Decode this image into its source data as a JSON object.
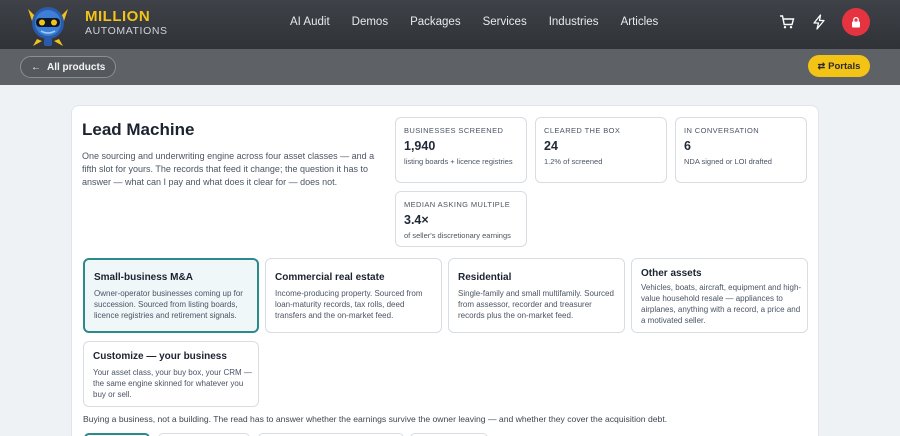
{
  "header": {
    "brand_top": "MILLION",
    "brand_bottom": "AUTOMATIONS",
    "nav": [
      "AI Audit",
      "Demos",
      "Packages",
      "Services",
      "Industries",
      "Articles"
    ],
    "icons": [
      "cart-icon",
      "bolt-icon",
      "lock-icon"
    ]
  },
  "subbar": {
    "back_label": "All products",
    "portals_label": "Portals"
  },
  "product": {
    "title": "Lead Machine",
    "description": "One sourcing and underwriting engine across four asset classes — and a fifth slot for yours. The records that feed it change; the question it has to answer — what can I pay and what does it clear for — does not."
  },
  "stats": [
    {
      "label": "BUSINESSES SCREENED",
      "value": "1,940",
      "note": "listing boards + licence registries"
    },
    {
      "label": "CLEARED THE BOX",
      "value": "24",
      "note": "1.2% of screened"
    },
    {
      "label": "IN CONVERSATION",
      "value": "6",
      "note": "NDA signed or LOI drafted"
    },
    {
      "label": "MEDIAN ASKING MULTIPLE",
      "value": "3.4×",
      "note": "of seller's discretionary earnings"
    }
  ],
  "asset_classes": [
    {
      "title": "Small-business M&A",
      "desc": "Owner-operator businesses coming up for succession. Sourced from listing boards, licence registries and retirement signals.",
      "active": true
    },
    {
      "title": "Commercial real estate",
      "desc": "Income-producing property. Sourced from loan-maturity records, tax rolls, deed transfers and the on-market feed.",
      "active": false
    },
    {
      "title": "Residential",
      "desc": "Single-family and small multifamily. Sourced from assessor, recorder and treasurer records plus the on-market feed.",
      "active": false
    },
    {
      "title": "Other assets",
      "desc": "Vehicles, boats, aircraft, equipment and high-value household resale — appliances to airplanes, anything with a record, a price and a motivated seller.",
      "active": false
    },
    {
      "title": "Customize — your business",
      "desc": "Your asset class, your buy box, your CRM — the same engine skinned for whatever you buy or sell.",
      "active": false
    }
  ],
  "footnote": "Buying a business, not a building. The read has to answer whether the earnings survive the owner leaving — and whether they cover the acquisition debt.",
  "colors": {
    "accent": "#f3c316",
    "active_border": "#2b8a8a",
    "danger": "#e5343f",
    "nav_bg": "#3f4248"
  }
}
